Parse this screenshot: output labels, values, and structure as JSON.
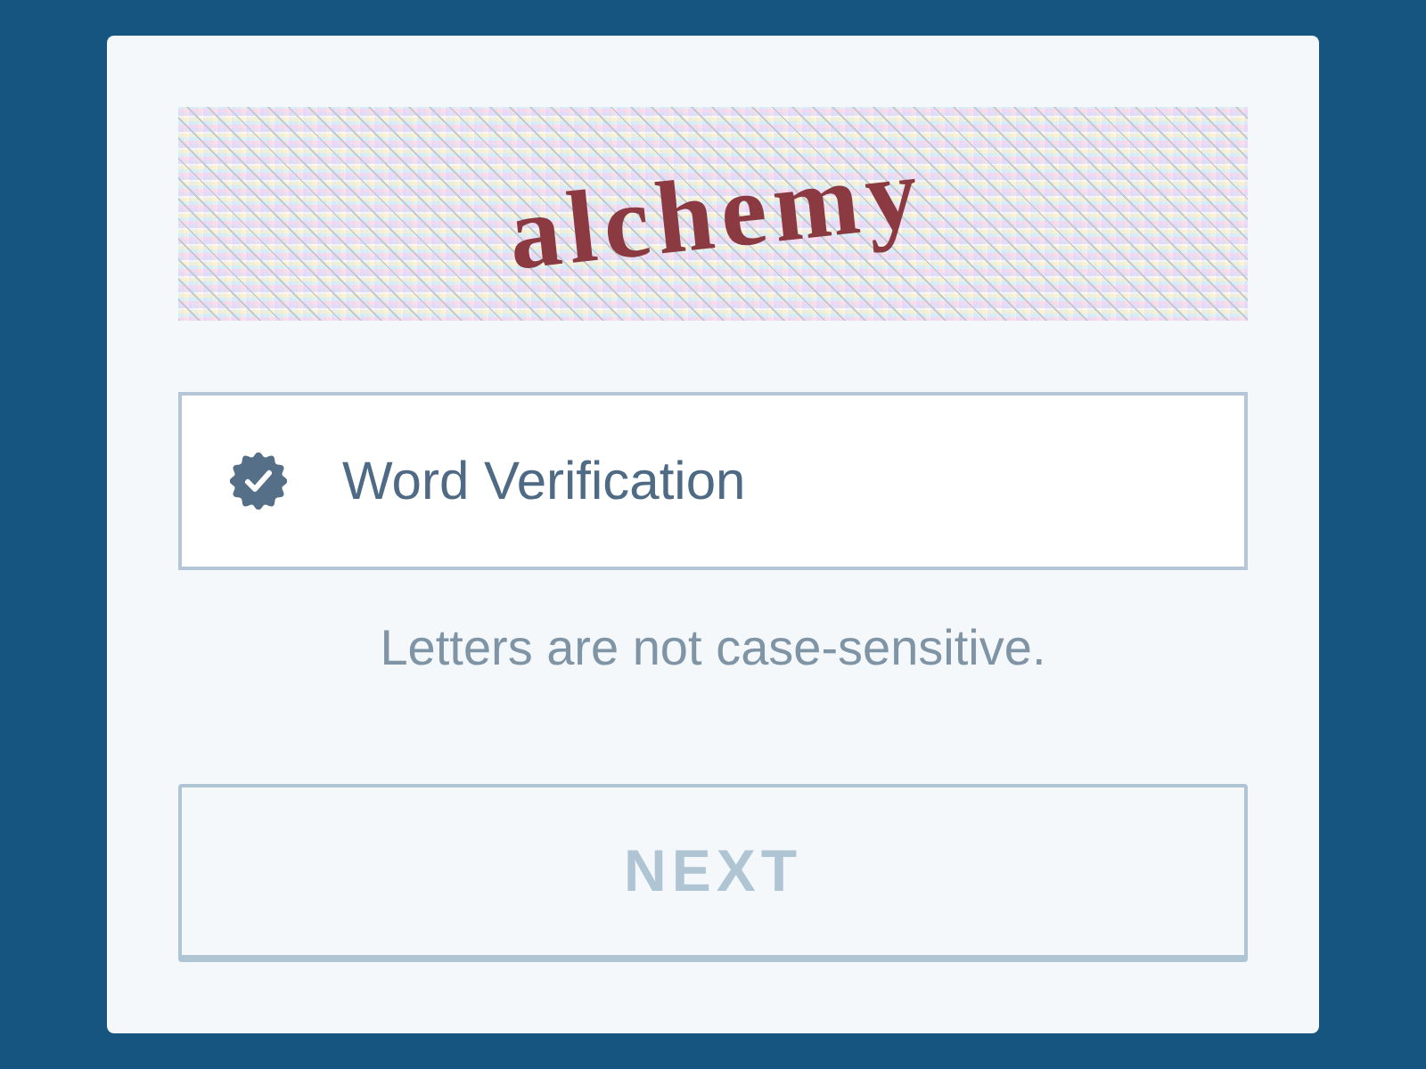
{
  "captcha": {
    "text": "alchemy"
  },
  "word_field": {
    "placeholder": "Word Verification",
    "verified": true
  },
  "hint": "Letters are not case-sensitive.",
  "next_button": {
    "label": "NEXT",
    "disabled": true
  }
}
